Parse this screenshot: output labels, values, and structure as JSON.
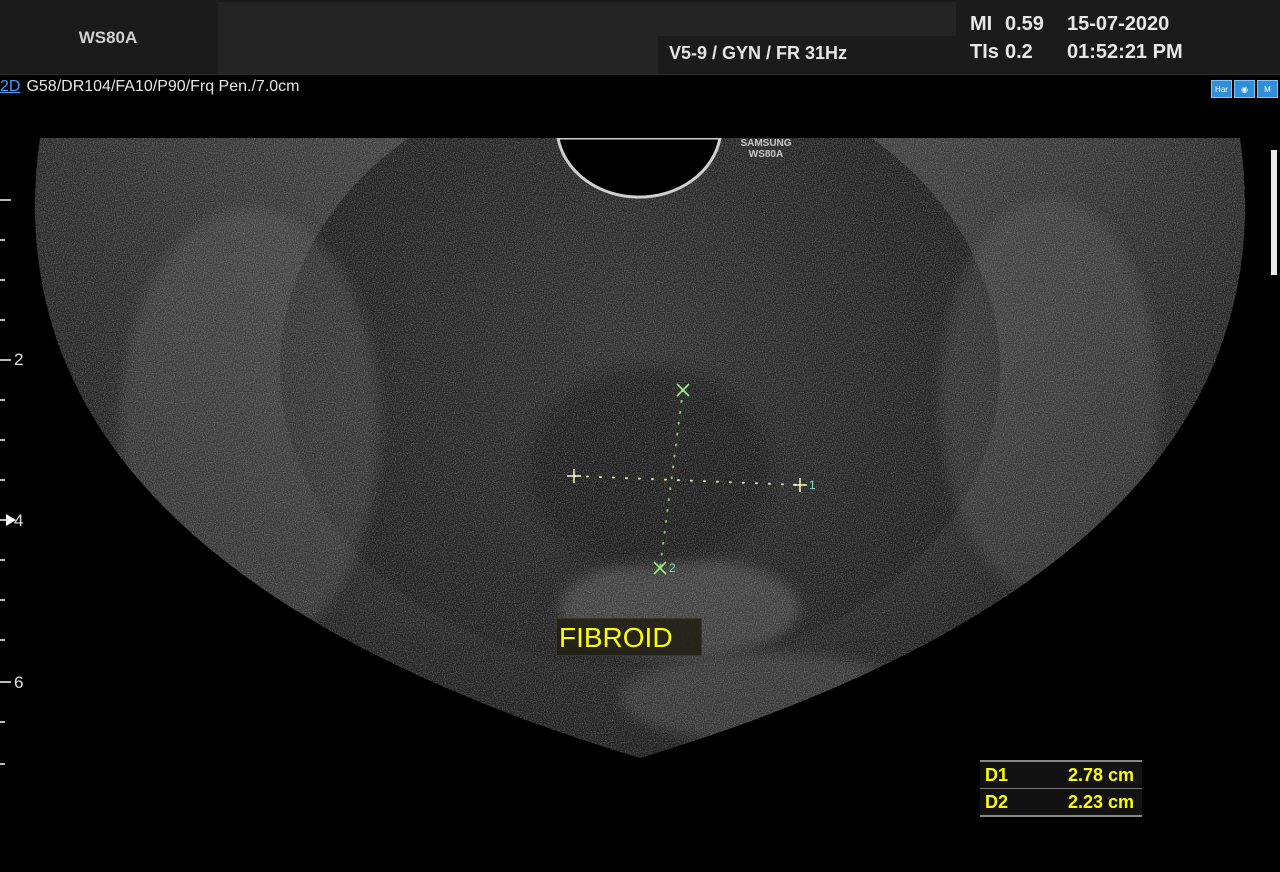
{
  "header": {
    "device": "WS80A",
    "probe_preset": "V5-9 / GYN / FR 31Hz",
    "mi_label": "MI",
    "mi_value": "0.59",
    "tis_label": "TIs",
    "tis_value": "0.2",
    "date": "15-07-2020",
    "time": "01:52:21 PM"
  },
  "imaging": {
    "mode": "2D",
    "params": "G58/DR104/FA10/P90/Frq Pen./7.0cm",
    "icons": [
      {
        "name": "harmonic-icon",
        "label": "Har"
      },
      {
        "name": "eye-icon",
        "label": "◉"
      },
      {
        "name": "filter-icon",
        "label": "M"
      }
    ]
  },
  "watermark": {
    "line1": "SAMSUNG",
    "line2": "WS80A"
  },
  "depth_scale": {
    "labels": [
      "2",
      "4",
      "6"
    ],
    "unit": "cm"
  },
  "annotation": {
    "text": "FIBROID"
  },
  "calipers": {
    "d1_marker": "1",
    "d2_marker": "2"
  },
  "measurements": [
    {
      "name": "D1",
      "value": "2.78 cm"
    },
    {
      "name": "D2",
      "value": "2.23 cm"
    }
  ],
  "colors": {
    "annotation": "#ffff00",
    "caliper": "#7fd060",
    "mode_link": "#3ea0ff"
  }
}
